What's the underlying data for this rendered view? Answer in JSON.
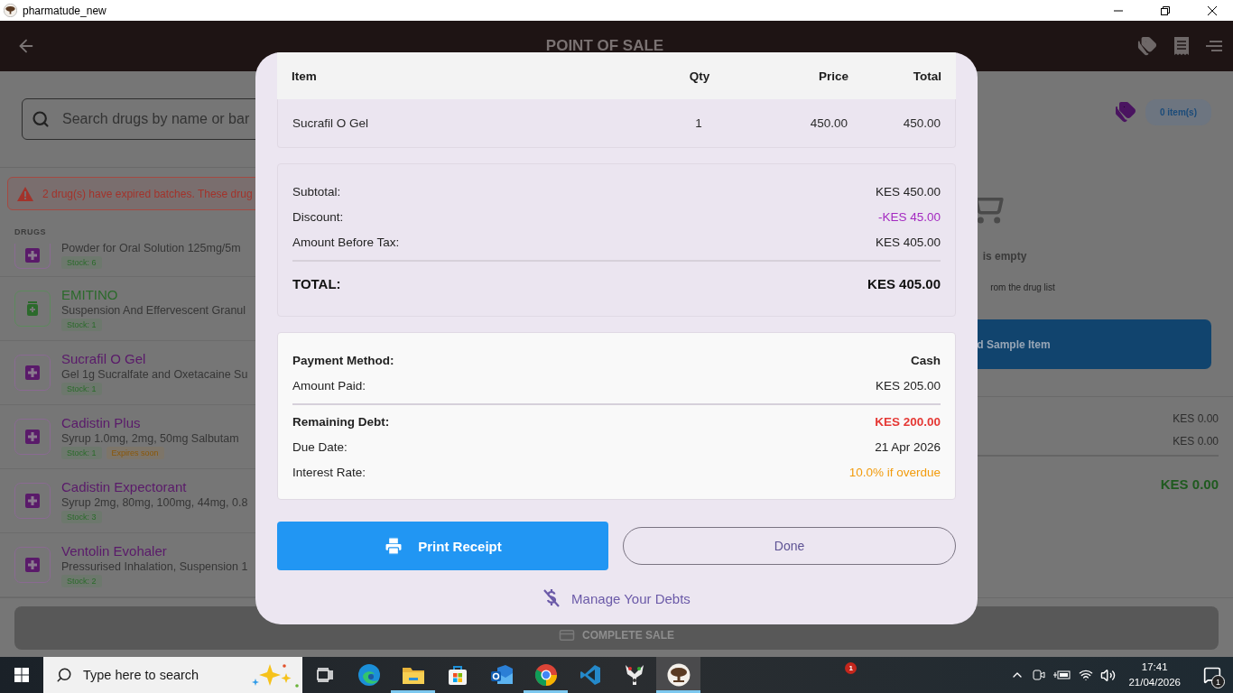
{
  "window": {
    "title": "pharmatude_new"
  },
  "header": {
    "title": "POINT OF SALE"
  },
  "search": {
    "placeholder": "Search drugs by name or bar"
  },
  "alert": {
    "text": "2 drug(s) have expired batches. These drug"
  },
  "drugs_heading": "DRUGS",
  "drugs": [
    {
      "kind": "cross",
      "description": "Powder for Oral Solution 125mg/5m",
      "badges": [
        {
          "kind": "stock",
          "text": "Stock: 6"
        }
      ]
    },
    {
      "kind": "bottle",
      "name": "EMITINO",
      "description": "Suspension And Effervescent Granul",
      "badges": [
        {
          "kind": "stock",
          "text": "Stock: 1"
        }
      ]
    },
    {
      "kind": "cross",
      "name": "Sucrafil O Gel",
      "description": "Gel 1g Sucralfate and Oxetacaine Su",
      "badges": [
        {
          "kind": "stock",
          "text": "Stock: 1"
        }
      ]
    },
    {
      "kind": "cross",
      "name": "Cadistin Plus",
      "description": "Syrup 1.0mg, 2mg, 50mg  Salbutam",
      "badges": [
        {
          "kind": "stock",
          "text": "Stock: 1"
        },
        {
          "kind": "expiry",
          "text": "Expires soon"
        }
      ]
    },
    {
      "kind": "cross",
      "name": "Cadistin Expectorant",
      "description": "Syrup 2mg, 80mg, 100mg, 44mg, 0.8",
      "badges": [
        {
          "kind": "stock",
          "text": "Stock: 3"
        }
      ]
    },
    {
      "kind": "cross",
      "name": "Ventolin Evohaler",
      "description": "Pressurised Inhalation, Suspension 1",
      "badges": [
        {
          "kind": "stock",
          "text": "Stock: 2"
        }
      ]
    }
  ],
  "cart": {
    "count": "0 item(s)",
    "empty_title": "is empty",
    "empty_hint": "rom the drug list",
    "sample_button": "d Sample Item",
    "totals": [
      "KES 0.00",
      "KES 0.00"
    ],
    "grand_total": "KES 0.00",
    "complete_button": "COMPLETE SALE"
  },
  "receipt": {
    "table": {
      "columns": [
        "Item",
        "Qty",
        "Price",
        "Total"
      ],
      "rows": [
        [
          "Sucrafil O Gel",
          "1",
          "450.00",
          "450.00"
        ]
      ]
    },
    "summary": [
      {
        "kind": "normal",
        "label": "Subtotal:",
        "value": "KES 450.00"
      },
      {
        "kind": "discount",
        "label": "Discount:",
        "value": "-KES 45.00"
      },
      {
        "kind": "normal",
        "label": "Amount Before Tax:",
        "value": "KES 405.00"
      }
    ],
    "total": {
      "label": "TOTAL:",
      "value": "KES 405.00"
    },
    "payment": [
      {
        "kind": "strong",
        "label": "Payment Method:",
        "value": "Cash"
      },
      {
        "kind": "normal",
        "label": "Amount Paid:",
        "value": "KES 205.00"
      }
    ],
    "debt": [
      {
        "kind": "debt",
        "label": "Remaining Debt:",
        "value": "KES 200.00"
      },
      {
        "kind": "normal",
        "label": "Due Date:",
        "value": "21 Apr 2026"
      },
      {
        "kind": "warning",
        "label": "Interest Rate:",
        "value": "10.0% if overdue"
      }
    ],
    "print_button": "Print Receipt",
    "done_button": "Done",
    "debts_link": "Manage Your Debts"
  },
  "taskbar": {
    "search_placeholder": "Type here to search",
    "apps": [
      {
        "kind": "taskview",
        "running": false,
        "selected": false
      },
      {
        "kind": "edge",
        "running": false,
        "selected": false
      },
      {
        "kind": "explorer",
        "running": true,
        "selected": false
      },
      {
        "kind": "store",
        "running": false,
        "selected": false
      },
      {
        "kind": "outlook",
        "running": false,
        "selected": false
      },
      {
        "kind": "chrome",
        "running": true,
        "selected": false
      },
      {
        "kind": "vscode",
        "running": false,
        "selected": false
      },
      {
        "kind": "yapp",
        "running": false,
        "selected": false
      },
      {
        "kind": "pharmatude",
        "running": true,
        "selected": true
      }
    ],
    "badge": "1",
    "time": "17:41",
    "date": "21/04/2026",
    "notifications": "1"
  }
}
